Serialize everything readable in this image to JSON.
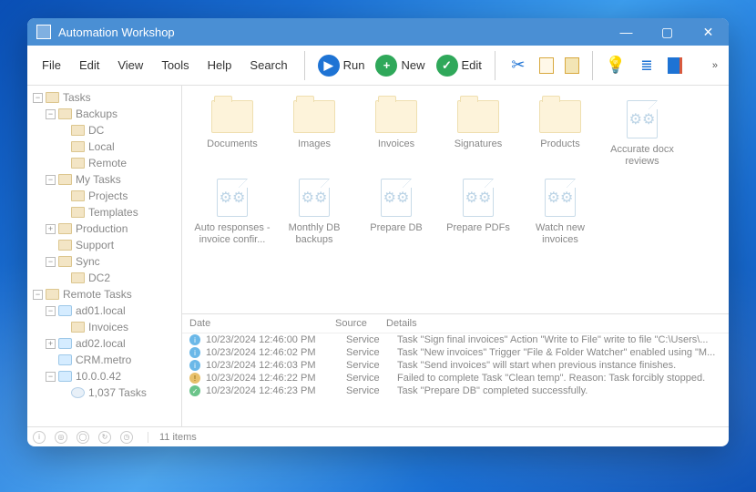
{
  "window": {
    "title": "Automation Workshop"
  },
  "menu": {
    "file": "File",
    "edit": "Edit",
    "view": "View",
    "tools": "Tools",
    "help": "Help",
    "search": "Search"
  },
  "toolbar": {
    "run": "Run",
    "new": "New",
    "edit": "Edit"
  },
  "tree": {
    "tasks": "Tasks",
    "backups": "Backups",
    "dc": "DC",
    "local": "Local",
    "remote": "Remote",
    "mytasks": "My Tasks",
    "projects": "Projects",
    "templates": "Templates",
    "production": "Production",
    "support": "Support",
    "sync": "Sync",
    "dc2": "DC2",
    "remotetasks": "Remote Tasks",
    "ad01": "ad01.local",
    "invoices": "Invoices",
    "ad02": "ad02.local",
    "crm": "CRM.metro",
    "ip": "10.0.0.42",
    "count": "1,037 Tasks"
  },
  "items": {
    "row1": [
      {
        "type": "folder",
        "label": "Documents"
      },
      {
        "type": "folder",
        "label": "Images"
      },
      {
        "type": "folder",
        "label": "Invoices"
      },
      {
        "type": "folder",
        "label": "Signatures"
      },
      {
        "type": "folder",
        "label": "Products"
      },
      {
        "type": "file",
        "label": "Accurate docx reviews"
      }
    ],
    "row2": [
      {
        "type": "file",
        "label": "Auto responses - invoice confir..."
      },
      {
        "type": "file",
        "label": "Monthly DB backups"
      },
      {
        "type": "file",
        "label": "Prepare DB"
      },
      {
        "type": "file",
        "label": "Prepare PDFs"
      },
      {
        "type": "file",
        "label": "Watch new invoices"
      }
    ]
  },
  "events": {
    "headers": {
      "date": "Date",
      "source": "Source",
      "details": "Details"
    },
    "rows": [
      {
        "icon": "info",
        "date": "10/23/2024 12:46:00 PM",
        "source": "Service",
        "details": "Task \"Sign final invoices\" Action \"Write to File\" write to file \"C:\\Users\\..."
      },
      {
        "icon": "info",
        "date": "10/23/2024 12:46:02 PM",
        "source": "Service",
        "details": "Task \"New invoices\" Trigger \"File & Folder Watcher\" enabled using \"M..."
      },
      {
        "icon": "info",
        "date": "10/23/2024 12:46:03 PM",
        "source": "Service",
        "details": "Task \"Send invoices\" will start when previous instance finishes."
      },
      {
        "icon": "warn",
        "date": "10/23/2024 12:46:22 PM",
        "source": "Service",
        "details": "Failed to complete Task \"Clean temp\". Reason: Task forcibly stopped."
      },
      {
        "icon": "ok",
        "date": "10/23/2024 12:46:23 PM",
        "source": "Service",
        "details": "Task \"Prepare DB\" completed successfully."
      }
    ]
  },
  "status": {
    "items": "11 items"
  }
}
